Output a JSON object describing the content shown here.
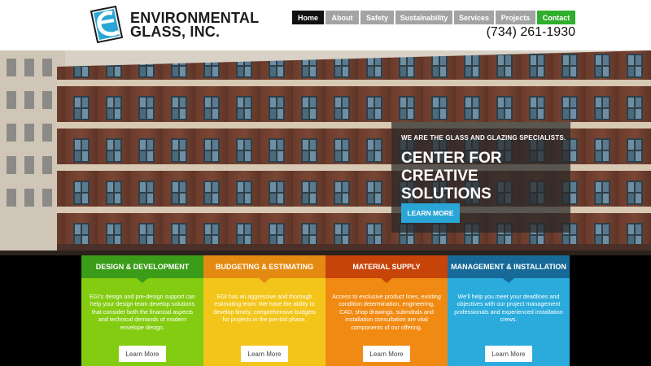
{
  "brand": {
    "name_line1": "ENVIRONMENTAL",
    "name_line2": "GLASS, INC.",
    "logo_icon": "egi-logo-icon",
    "colors": {
      "blue": "#2aa6d6",
      "dark": "#1b1b1b"
    }
  },
  "nav": {
    "items": [
      {
        "label": "Home",
        "state": "active"
      },
      {
        "label": "About"
      },
      {
        "label": "Safety"
      },
      {
        "label": "Sustainability"
      },
      {
        "label": "Services"
      },
      {
        "label": "Projects"
      },
      {
        "label": "Contact",
        "color": "#2fae2b"
      }
    ]
  },
  "phone": "(734) 261-1930",
  "hero": {
    "kicker": "WE ARE THE GLASS AND GLAZING SPECIALISTS.",
    "title": "CENTER FOR CREATIVE SOLUTIONS",
    "button": "LEARN MORE"
  },
  "services": [
    {
      "title": "DESIGN & DEVELOPMENT",
      "text": "EGI's design and pre-design support can help your design team develop solutions that consider both the financial aspects and technical demands of modern envelope design.",
      "button": "Learn More",
      "header_color": "#3a9c18",
      "body_color": "#84cc12"
    },
    {
      "title": "BUDGETING & ESTIMATING",
      "text": "EGI has an aggressive and thorough estimating team. We have the ability to develop timely, comprehensive budgets for projects in the pre-bid phase.",
      "button": "Learn More",
      "header_color": "#e58a10",
      "body_color": "#f3c51b"
    },
    {
      "title": "MATERIAL SUPPLY",
      "text": "Access to exclusive product lines, existing condition determination, engineering, CAD, shop drawings, submittals and installation consultation are vital components of our offering.",
      "button": "Learn More",
      "header_color": "#c74409",
      "body_color": "#f08a12"
    },
    {
      "title": "MANAGEMENT & INSTALLATION",
      "text": "We'll help you meet your deadlines and objectives with our project management professionals and experienced installation crews.",
      "button": "Learn More",
      "header_color": "#176a98",
      "body_color": "#2aabdc"
    }
  ]
}
